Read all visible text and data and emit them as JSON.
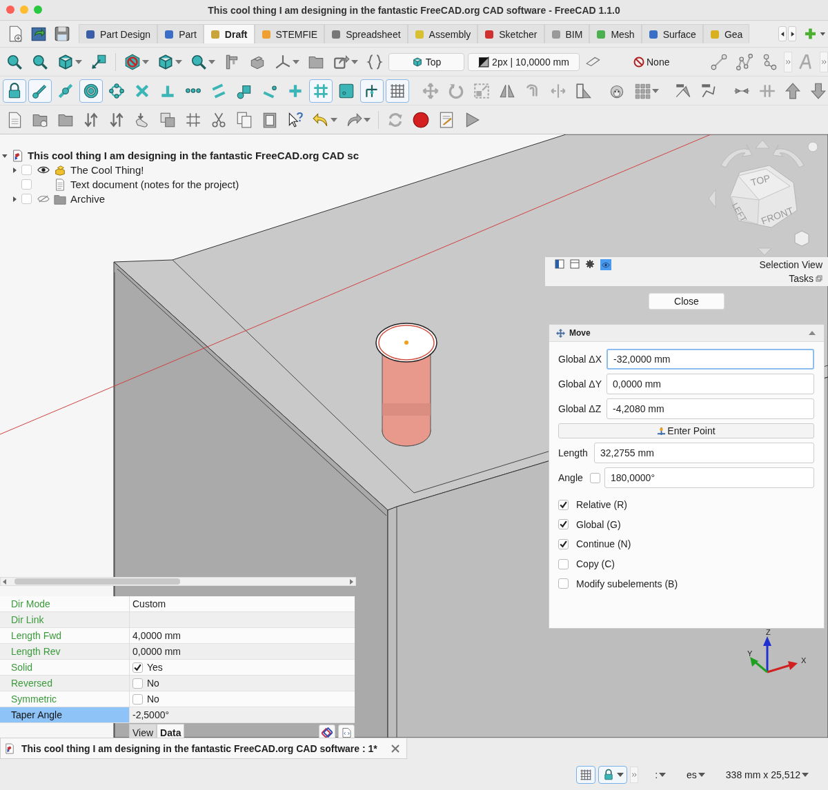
{
  "window": {
    "title": "This cool thing I am designing in the fantastic FreeCAD.org CAD software - FreeCAD 1.1.0"
  },
  "workbench_tabs": [
    {
      "label": "Part Design",
      "selected": false
    },
    {
      "label": "Part",
      "selected": false
    },
    {
      "label": "Draft",
      "selected": true
    },
    {
      "label": "STEMFIE",
      "selected": false
    },
    {
      "label": "Spreadsheet",
      "selected": false
    },
    {
      "label": "Assembly",
      "selected": false
    },
    {
      "label": "Sketcher",
      "selected": false
    },
    {
      "label": "BIM",
      "selected": false
    },
    {
      "label": "Mesh",
      "selected": false
    },
    {
      "label": "Surface",
      "selected": false
    },
    {
      "label": "Gea",
      "selected": false
    }
  ],
  "view_toolbar": {
    "view_button": "Top",
    "style_button": "2px | 10,0000 mm",
    "layer_button": "None"
  },
  "snap_toolbar": [
    {
      "on": true
    },
    {
      "on": true
    },
    {
      "on": false
    },
    {
      "on": true
    },
    {
      "on": false
    },
    {
      "on": false
    },
    {
      "on": false
    },
    {
      "on": false
    },
    {
      "on": false
    },
    {
      "on": false
    },
    {
      "on": false
    },
    {
      "on": false
    },
    {
      "on": true
    },
    {
      "on": false
    },
    {
      "on": true
    },
    {
      "on": true
    }
  ],
  "tree": {
    "root": {
      "label": "This cool thing I am designing in the fantastic FreeCAD.org CAD sc",
      "expanded": true
    },
    "items": [
      {
        "label": "The Cool Thing!",
        "kind": "part",
        "visible": true,
        "expandable": true,
        "checked": false
      },
      {
        "label": "Text document (notes for the project)",
        "kind": "document",
        "expandable": false,
        "checked": false
      },
      {
        "label": "Archive",
        "kind": "folder",
        "visible": false,
        "expandable": true,
        "checked": false
      }
    ]
  },
  "navigation_cube": {
    "faces": [
      "TOP",
      "LEFT",
      "FRONT"
    ]
  },
  "axis_labels": [
    "X",
    "Y",
    "Z"
  ],
  "task_panel": {
    "view_label": "Selection View",
    "tasks_label": "Tasks",
    "close_button": "Close",
    "section_title": "Move",
    "fields": [
      {
        "label": "Global ΔX",
        "value": "-32,0000 mm",
        "focused": true
      },
      {
        "label": "Global ΔY",
        "value": "0,0000 mm",
        "focused": false
      },
      {
        "label": "Global ΔZ",
        "value": "-4,2080 mm",
        "focused": false
      }
    ],
    "enter_point_button": "Enter Point",
    "length": {
      "label": "Length",
      "value": "32,2755 mm"
    },
    "angle": {
      "label": "Angle",
      "value": "180,0000°",
      "checked": false
    },
    "options": [
      {
        "label": "Relative (R)",
        "checked": true
      },
      {
        "label": "Global (G)",
        "checked": true
      },
      {
        "label": "Continue (N)",
        "checked": true
      },
      {
        "label": "Copy (C)",
        "checked": false
      },
      {
        "label": "Modify subelements (B)",
        "checked": false
      }
    ]
  },
  "properties": {
    "rows": [
      {
        "name": "Dir Mode",
        "kind": "text",
        "value": "Custom",
        "selected": false
      },
      {
        "name": "Dir Link",
        "kind": "text",
        "selected": false
      },
      {
        "name": "Length Fwd",
        "kind": "text",
        "value": "4,0000 mm",
        "selected": false
      },
      {
        "name": "Length Rev",
        "kind": "text",
        "value": "0,0000 mm",
        "selected": false
      },
      {
        "name": "Solid",
        "kind": "checkbox",
        "value": "Yes",
        "checked": true,
        "selected": false
      },
      {
        "name": "Reversed",
        "kind": "checkbox",
        "value": "No",
        "checked": false,
        "selected": false
      },
      {
        "name": "Symmetric",
        "kind": "checkbox",
        "value": "No",
        "checked": false,
        "selected": false
      },
      {
        "name": "Taper Angle",
        "kind": "text",
        "value": "-2,5000°",
        "selected": true
      }
    ],
    "tabs": [
      {
        "label": "View",
        "selected": false
      },
      {
        "label": "Data",
        "selected": true
      }
    ]
  },
  "document_tab": {
    "label": "This cool thing I am designing in the fantastic FreeCAD.org CAD software : 1*"
  },
  "status_bar": {
    "grid_on": true,
    "lock_on": true,
    "items": [
      ":",
      "es",
      "338 mm x 25,512"
    ]
  }
}
